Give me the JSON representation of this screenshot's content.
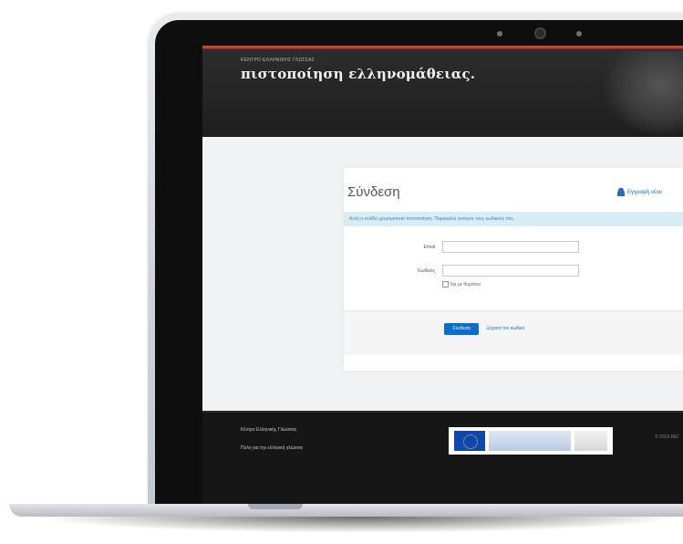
{
  "site": {
    "subtitle": "ΚΕΝΤΡΟ ΕΛΛΗΝΙΚΗΣ ΓΛΩΣΣΑΣ",
    "brand": "πιστοποίηση ελληνομάθειας."
  },
  "login": {
    "title": "Σύνδεση",
    "register_link": "Εγγραφή νέου",
    "info": "Αυτή η σελίδα χρησιμοποιεί πιστοποίηση. Παρακαλώ εισάγετε τους κωδικούς σας.",
    "email_label": "Email",
    "password_label": "Κωδικός",
    "remember_label": "Να με θυμάσαι",
    "submit_label": "Σύνδεση",
    "forgot_label": "Ξέχασα τον κωδικό"
  },
  "footer": {
    "link1": "Κέντρο Ελληνικής Γλώσσας",
    "link2": "Πύλη για την ελληνική γλώσσα",
    "copyright": "© 2013 ΚΕΓ"
  },
  "colors": {
    "accent": "#0b6ecb",
    "header_bg": "#1e1e1e",
    "info_bg": "#d9edf7"
  }
}
